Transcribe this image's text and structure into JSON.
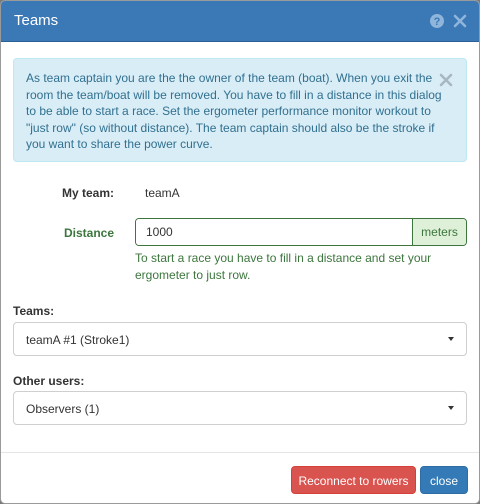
{
  "dialog": {
    "title": "Teams",
    "icons": {
      "help": "question-circle-icon",
      "close": "close-icon"
    }
  },
  "alert": {
    "text": "As team captain you are the the owner of the team (boat). When you exit the room the team/boat will be removed. You have to fill in a distance in this dialog to be able to start a race. Set the ergometer performance monitor workout to \"just row\" (so without distance). The team captain should also be the stroke if you want to share the power curve.",
    "close_icon": "close-icon"
  },
  "my_team": {
    "label": "My team:",
    "value": "teamA"
  },
  "distance": {
    "label": "Distance",
    "value": "1000",
    "unit": "meters",
    "help": "To start a race you have to fill in a distance and set your ergometer to just row."
  },
  "teams": {
    "label": "Teams:",
    "selected": "teamA #1 (Stroke1)"
  },
  "other_users": {
    "label": "Other users:",
    "selected": "Observers (1)"
  },
  "footer": {
    "reconnect_label": "Reconnect to rowers",
    "close_label": "close"
  },
  "colors": {
    "header": "#3b78b6",
    "alert_bg": "#d9edf7",
    "alert_text": "#31708f",
    "success": "#3c763d",
    "danger": "#d9534f",
    "primary": "#337ab7"
  }
}
